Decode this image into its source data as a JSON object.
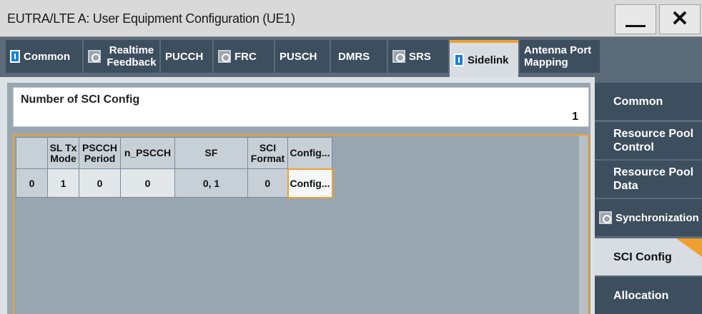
{
  "window": {
    "title": "EUTRA/LTE A: User Equipment Configuration (UE1)",
    "close_glyph": "✕"
  },
  "tabs": [
    {
      "label": "Common",
      "state": "on"
    },
    {
      "label": "Realtime Feedback",
      "state": "off"
    },
    {
      "label": "PUCCH",
      "state": "none"
    },
    {
      "label": "FRC",
      "state": "off"
    },
    {
      "label": "PUSCH",
      "state": "none"
    },
    {
      "label": "DMRS",
      "state": "none"
    },
    {
      "label": "SRS",
      "state": "off"
    },
    {
      "label": "Sidelink",
      "state": "on",
      "active": true
    },
    {
      "label": "Antenna Port Mapping",
      "state": "none"
    }
  ],
  "sci_config": {
    "label": "Number of SCI Config",
    "value": "1"
  },
  "table": {
    "headers": [
      "",
      "SL Tx Mode",
      "PSCCH Period",
      "n_PSCCH",
      "SF",
      "SCI Format",
      "Config..."
    ],
    "rows": [
      [
        "0",
        "1",
        "0",
        "0",
        "0, 1",
        "0",
        "Config..."
      ]
    ]
  },
  "sidebar": [
    {
      "label": "Common"
    },
    {
      "label": "Resource Pool Control"
    },
    {
      "label": "Resource Pool Data"
    },
    {
      "label": "Synchronization",
      "state": "off"
    },
    {
      "label": "SCI Config",
      "active": true
    },
    {
      "label": "Allocation"
    }
  ],
  "colors": {
    "accent": "#f0a030",
    "state_on": "#1e7fd6",
    "tab_bg": "#3d4e5e",
    "active_bg": "#d7dde2"
  }
}
